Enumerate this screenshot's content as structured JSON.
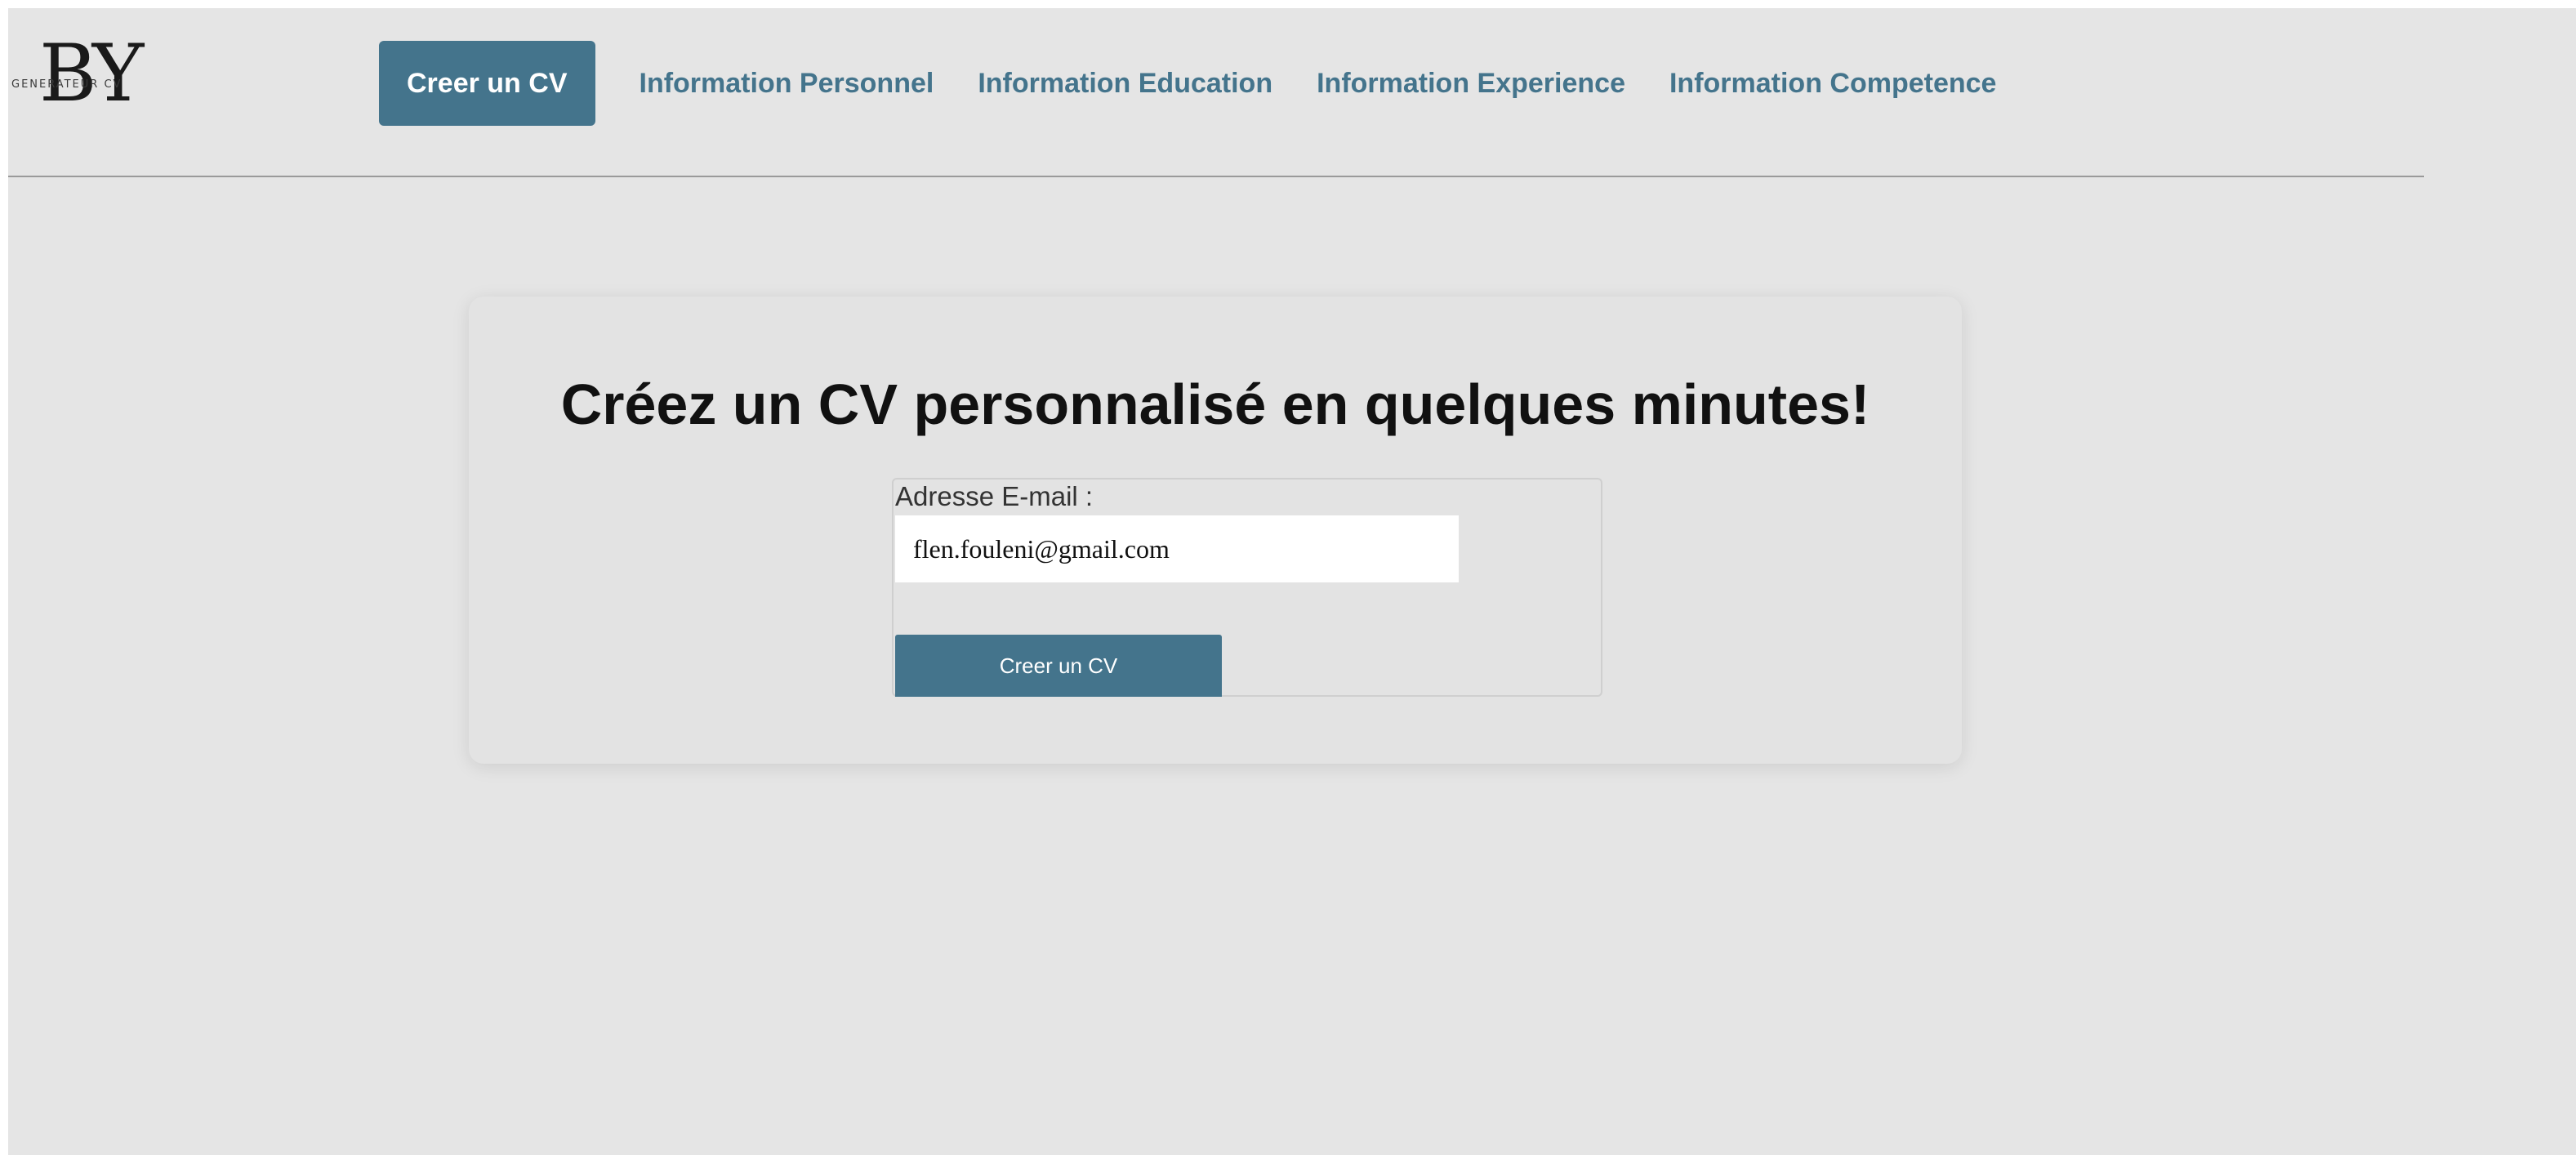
{
  "logo": {
    "mark": "BY",
    "subtitle": "GENERATEUR CV"
  },
  "nav": {
    "active_label": "Creer un CV",
    "links": [
      {
        "label": "Information Personnel"
      },
      {
        "label": "Information Education"
      },
      {
        "label": "Information Experience"
      },
      {
        "label": "Information Competence"
      }
    ]
  },
  "card": {
    "headline": "Créez un CV personnalisé en quelques minutes!",
    "form": {
      "email_label": "Adresse E-mail :",
      "email_value": "flen.fouleni@gmail.com",
      "submit_label": "Creer un CV"
    }
  },
  "colors": {
    "accent": "#44748c",
    "background": "#e5e5e5",
    "card": "#e3e3e3"
  }
}
